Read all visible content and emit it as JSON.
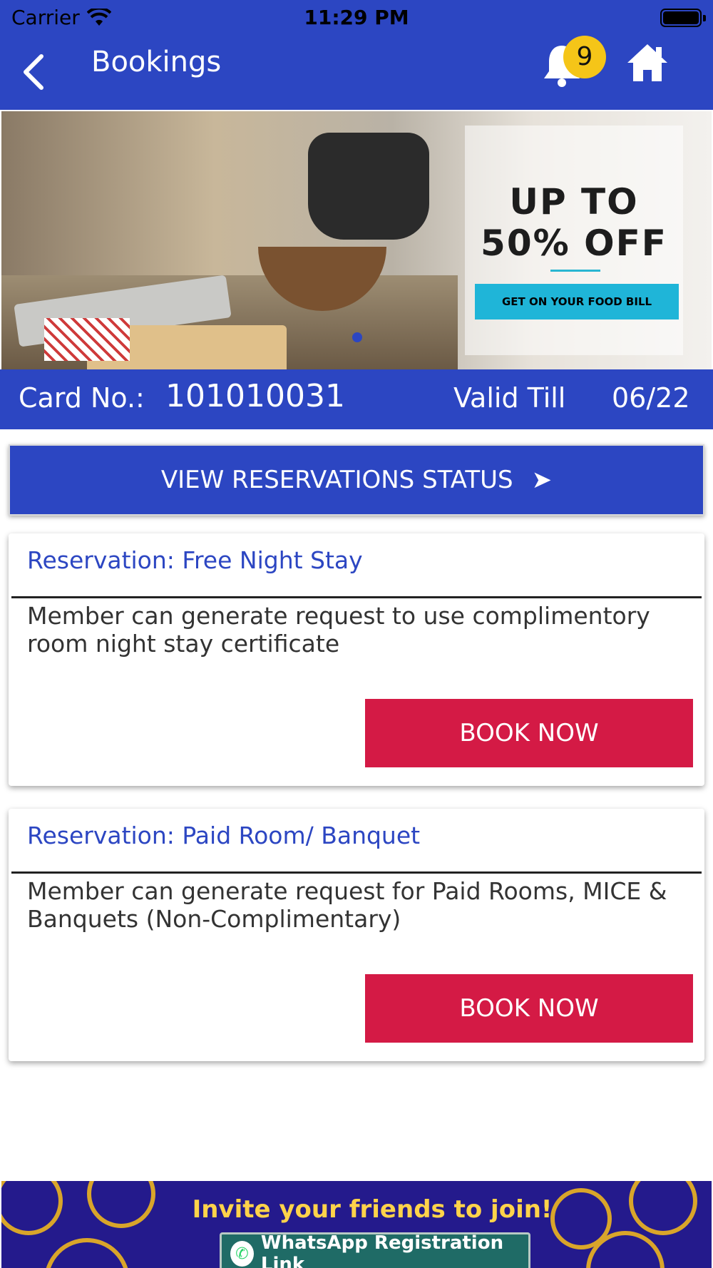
{
  "status_bar": {
    "carrier": "Carrier",
    "time": "11:29 PM"
  },
  "navbar": {
    "title": "Bookings",
    "notification_count": "9"
  },
  "banner": {
    "headline_1": "UP TO",
    "headline_2": "50% OFF",
    "tag": "GET ON YOUR FOOD BILL"
  },
  "card": {
    "label": "Card No.:",
    "number": "101010031",
    "valid_label": "Valid Till",
    "valid_value": "06/22"
  },
  "view_button": {
    "label": "VIEW RESERVATIONS STATUS",
    "arrow": "➤"
  },
  "reservations": [
    {
      "title": "Reservation: Free Night Stay",
      "description": "Member can generate request to use complimentory room night stay certificate",
      "button": "BOOK NOW"
    },
    {
      "title": "Reservation: Paid Room/ Banquet",
      "description": "Member can generate request for Paid Rooms, MICE & Banquets (Non-Complimentary)",
      "button": "BOOK NOW"
    }
  ],
  "invite_banner": {
    "headline": "Invite your friends to join!",
    "link_label": "WhatsApp Registration Link"
  },
  "colors": {
    "primary": "#2c46c2",
    "accent": "#d41a45",
    "badge": "#f5c518"
  }
}
